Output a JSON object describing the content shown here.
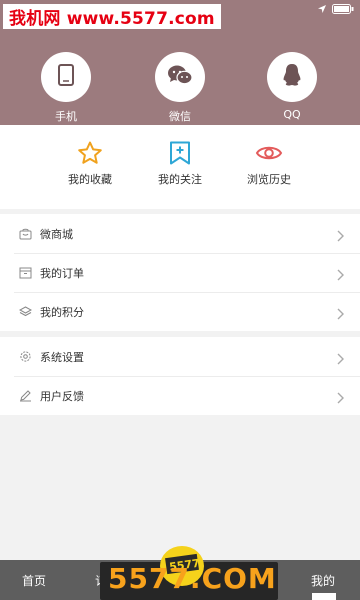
{
  "watermark": {
    "top_text": "我机网 www.5577.com",
    "bottom_text": "5577.COM"
  },
  "login": {
    "phone_label": "手机",
    "wechat_label": "微信",
    "qq_label": "QQ"
  },
  "quick_links": {
    "favorites_label": "我的收藏",
    "follows_label": "我的关注",
    "history_label": "浏览历史"
  },
  "menu_group_1": [
    {
      "label": "微商城",
      "icon": "shopping-bag-icon"
    },
    {
      "label": "我的订单",
      "icon": "order-box-icon"
    },
    {
      "label": "我的积分",
      "icon": "layers-icon"
    }
  ],
  "menu_group_2": [
    {
      "label": "系统设置",
      "icon": "gear-icon"
    },
    {
      "label": "用户反馈",
      "icon": "pencil-icon"
    }
  ],
  "bottom_nav": {
    "home_label": "首页",
    "second_label_partial": "订",
    "mine_label": "我的"
  },
  "colors": {
    "header_bg": "#9c7b7e",
    "star_accent": "#f0a21e",
    "bookmark_accent": "#2ea7d6",
    "eye_accent": "#e35b5b",
    "bottom_nav_bg": "#5e5e5e"
  }
}
